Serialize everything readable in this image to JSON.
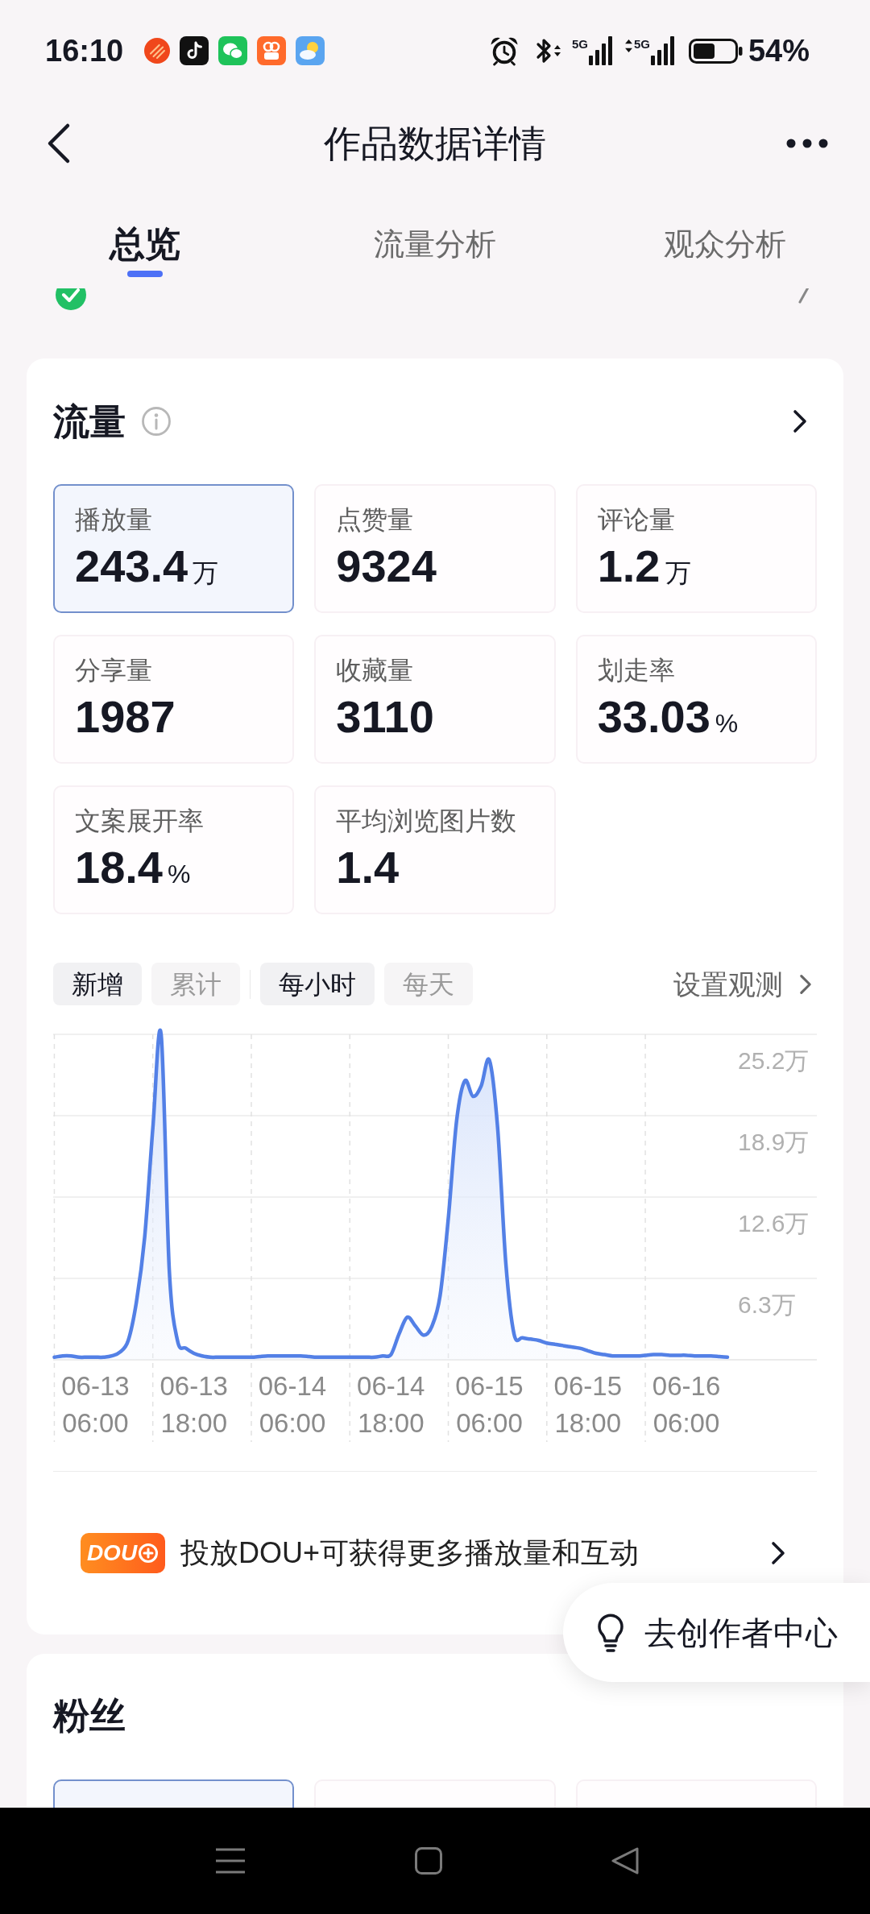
{
  "status_bar": {
    "time": "16:10",
    "network": [
      {
        "label": "5G",
        "activity": false
      },
      {
        "label": "5G",
        "activity": true
      }
    ],
    "battery": "54%"
  },
  "header": {
    "title": "作品数据详情"
  },
  "tabs": [
    {
      "label": "总览",
      "selected": true
    },
    {
      "label": "流量分析",
      "selected": false
    },
    {
      "label": "观众分析",
      "selected": false
    }
  ],
  "traffic_card": {
    "title": "流量",
    "metrics": [
      {
        "label": "播放量",
        "value": "243.4",
        "unit": "万",
        "selected": true
      },
      {
        "label": "点赞量",
        "value": "9324",
        "selected": false
      },
      {
        "label": "评论量",
        "value": "1.2",
        "unit": "万",
        "selected": false
      },
      {
        "label": "分享量",
        "value": "1987",
        "selected": false
      },
      {
        "label": "收藏量",
        "value": "3110",
        "selected": false
      },
      {
        "label": "划走率",
        "value": "33.03",
        "unit": "%",
        "selected": false
      },
      {
        "label": "文案展开率",
        "value": "18.4",
        "unit": "%",
        "selected": false
      },
      {
        "label": "平均浏览图片数",
        "value": "1.4",
        "selected": false
      }
    ],
    "filters": [
      {
        "label": "新增",
        "selected": true
      },
      {
        "label": "累计",
        "selected": false
      }
    ],
    "periods": [
      {
        "label": "每小时",
        "selected": true
      },
      {
        "label": "每天",
        "selected": false
      }
    ],
    "observe_link": "设置观测",
    "chart_data": {
      "type": "area",
      "grid": true,
      "categories": [
        null,
        null,
        null,
        null,
        null,
        "06-13\n06:00",
        null,
        null,
        null,
        null,
        null,
        null,
        null,
        null,
        null,
        null,
        null,
        "06-13\n18:00",
        null,
        null,
        null,
        null,
        null,
        null,
        null,
        null,
        null,
        null,
        null,
        "06-14\n06:00",
        null,
        null,
        null,
        null,
        null,
        null,
        null,
        null,
        null,
        null,
        null,
        "06-14\n18:00",
        null,
        null,
        null,
        null,
        null,
        null,
        null,
        null,
        null,
        null,
        null,
        "06-15\n06:00",
        null,
        null,
        null,
        null,
        null,
        null,
        null,
        null,
        null,
        null,
        null,
        "06-15\n18:00",
        null,
        null,
        null,
        null,
        null,
        null,
        null,
        null,
        null,
        null,
        null,
        "06-16\n06:00",
        null,
        null,
        null,
        null,
        null
      ],
      "series": [
        {
          "color": "#5380e6",
          "values": [
            0.2,
            0.3,
            0.3,
            0.2,
            0.2,
            0.2,
            0.2,
            0.3,
            0.6,
            1.5,
            4.5,
            9.5,
            18.0,
            25.2,
            7.0,
            1.5,
            0.9,
            0.5,
            0.3,
            0.2,
            0.2,
            0.2,
            0.2,
            0.2,
            0.2,
            0.25,
            0.3,
            0.3,
            0.3,
            0.3,
            0.3,
            0.25,
            0.2,
            0.2,
            0.2,
            0.2,
            0.2,
            0.2,
            0.2,
            0.2,
            0.3,
            0.4,
            2.0,
            3.3,
            2.6,
            1.9,
            2.6,
            5.0,
            11.0,
            18.5,
            21.6,
            20.4,
            21.2,
            23.2,
            18.0,
            7.5,
            2.0,
            1.7,
            1.6,
            1.5,
            1.3,
            1.2,
            1.1,
            1.0,
            0.9,
            0.7,
            0.5,
            0.4,
            0.3,
            0.3,
            0.3,
            0.3,
            0.35,
            0.4,
            0.4,
            0.35,
            0.35,
            0.35,
            0.3,
            0.3,
            0.3,
            0.25,
            0.2
          ]
        }
      ],
      "ylim": [
        0,
        25.2
      ],
      "yticks": [
        {
          "value": 6.3,
          "label": "6.3万"
        },
        {
          "value": 12.6,
          "label": "12.6万"
        },
        {
          "value": 18.9,
          "label": "18.9万"
        },
        {
          "value": 25.2,
          "label": "25.2万"
        }
      ]
    },
    "promo": {
      "logo_text": "DOU",
      "text": "投放DOU+可获得更多播放量和互动"
    }
  },
  "floating_button": {
    "label": "去创作者中心"
  },
  "fans_card": {
    "title": "粉丝",
    "metrics": [
      {
        "selected": true
      },
      {
        "selected": false
      },
      {
        "selected": false
      }
    ]
  }
}
